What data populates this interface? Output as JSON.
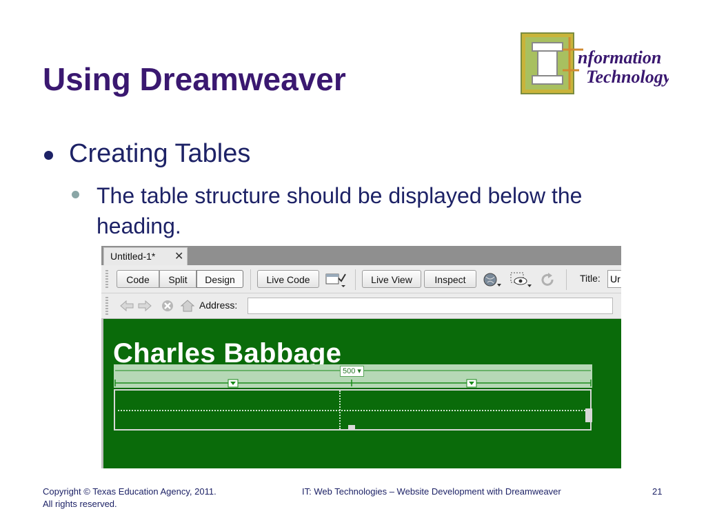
{
  "slide": {
    "title": "Using Dreamweaver",
    "bullet1": "Creating Tables",
    "bullet2": "The table structure should be displayed below the heading.",
    "logo": {
      "line1": "nformation",
      "line2": "Technology",
      "letters": "IT"
    }
  },
  "screenshot": {
    "tab_name": "Untitled-1*",
    "close_glyph": "✕",
    "toolbar": {
      "code": "Code",
      "split": "Split",
      "design": "Design",
      "live_code": "Live Code",
      "live_view": "Live View",
      "inspect": "Inspect",
      "title_label": "Title:",
      "title_value": "Ur"
    },
    "address_label": "Address:",
    "page_heading": "Charles Babbage",
    "table_width": "500"
  },
  "footer": {
    "copyright_line1": "Copyright © Texas Education Agency, 2011.",
    "copyright_line2": "All rights reserved.",
    "course": "IT: Web Technologies – Website Development with Dreamweaver",
    "page_number": "21"
  },
  "colors": {
    "title": "#3a1870",
    "bullet_text": "#1d2266",
    "design_bg": "#0a6b0a"
  }
}
